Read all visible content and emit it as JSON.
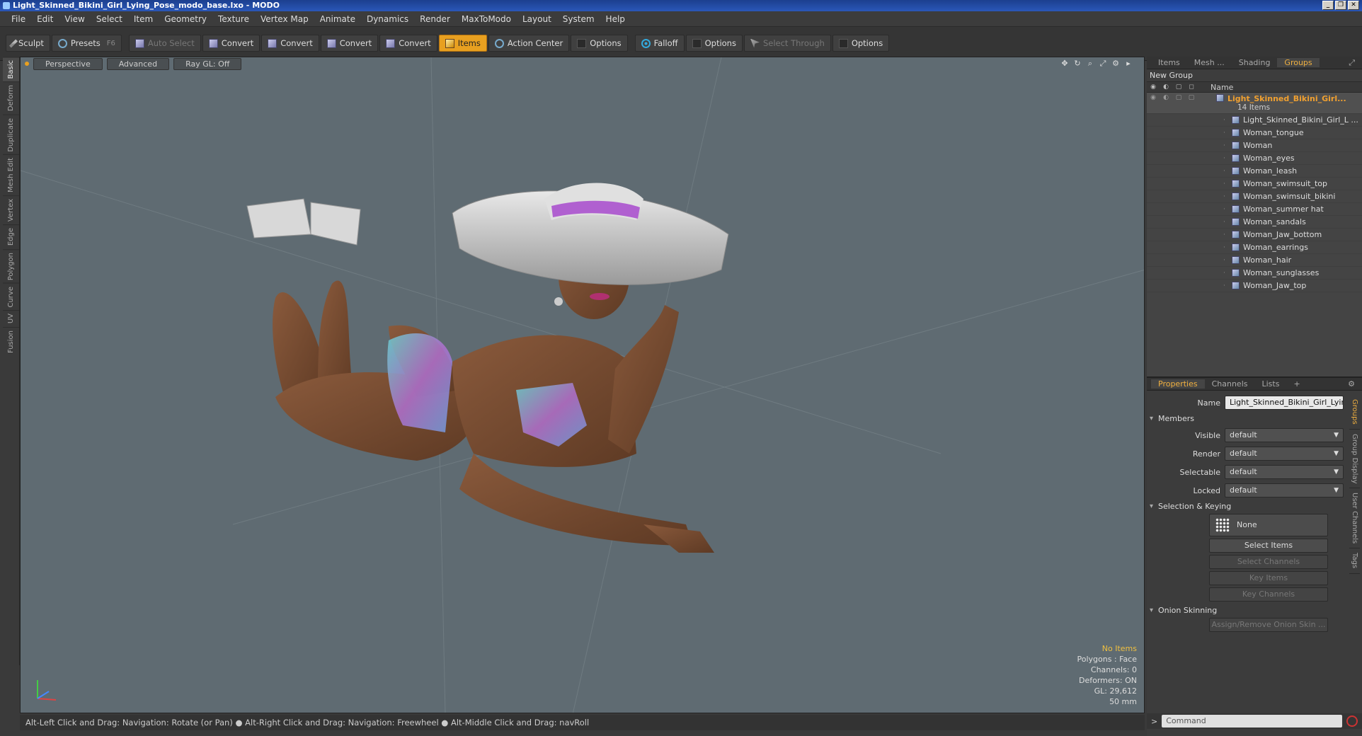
{
  "window": {
    "title": "Light_Skinned_Bikini_Girl_Lying_Pose_modo_base.lxo - MODO",
    "controls": [
      "_",
      "❐",
      "✕"
    ]
  },
  "menu": [
    "File",
    "Edit",
    "View",
    "Select",
    "Item",
    "Geometry",
    "Texture",
    "Vertex Map",
    "Animate",
    "Dynamics",
    "Render",
    "MaxToModo",
    "Layout",
    "System",
    "Help"
  ],
  "toolbar": {
    "sculpt": "Sculpt",
    "presets": "Presets",
    "presets_key": "F6",
    "auto_select": "Auto Select",
    "convert": "Convert",
    "items": "Items",
    "action_center": "Action Center",
    "options": "Options",
    "falloff": "Falloff",
    "select_through": "Select Through"
  },
  "left_tabs": [
    "Basic",
    "Deform",
    "Duplicate",
    "Mesh Edit",
    "Vertex",
    "Edge",
    "Polygon",
    "Curve",
    "UV",
    "Fusion"
  ],
  "viewport": {
    "view_mode": "Perspective",
    "shading": "Advanced",
    "raygl": "Ray GL: Off",
    "stats": {
      "selection": "No Items",
      "polygons": "Polygons : Face",
      "channels": "Channels: 0",
      "deformers": "Deformers: ON",
      "gl": "GL: 29,612",
      "scale": "50 mm"
    }
  },
  "status_bar": "Alt-Left Click and Drag: Navigation: Rotate (or Pan) ● Alt-Right Click and Drag: Navigation: Freewheel ● Alt-Middle Click and Drag: navRoll",
  "right_panel": {
    "tabs": [
      "Items",
      "Mesh ...",
      "Shading",
      "Groups"
    ],
    "active_tab": "Groups",
    "new_group": "New Group",
    "name_header": "Name",
    "root": {
      "name": "Light_Skinned_Bikini_Girl...",
      "count": "14 Items"
    },
    "items": [
      "Light_Skinned_Bikini_Girl_L ...",
      "Woman_tongue",
      "Woman",
      "Woman_eyes",
      "Woman_leash",
      "Woman_swimsuit_top",
      "Woman_swimsuit_bikini",
      "Woman_summer hat",
      "Woman_sandals",
      "Woman_Jaw_bottom",
      "Woman_earrings",
      "Woman_hair",
      "Woman_sunglasses",
      "Woman_Jaw_top"
    ],
    "side_tabs": [
      "Groups",
      "Group Display",
      "User Channels",
      "Tags"
    ],
    "prop_tabs": [
      "Properties",
      "Channels",
      "Lists",
      "+"
    ],
    "properties": {
      "name_label": "Name",
      "name_value": "Light_Skinned_Bikini_Girl_Lying_F",
      "members_section": "Members",
      "rows": [
        {
          "label": "Visible",
          "value": "default"
        },
        {
          "label": "Render",
          "value": "default"
        },
        {
          "label": "Selectable",
          "value": "default"
        },
        {
          "label": "Locked",
          "value": "default"
        }
      ],
      "selection_section": "Selection & Keying",
      "none_btn": "None",
      "select_items": "Select Items",
      "select_channels": "Select Channels",
      "key_items": "Key Items",
      "key_channels": "Key Channels",
      "onion_section": "Onion Skinning",
      "assign_onion": "Assign/Remove Onion Skin ..."
    },
    "command_placeholder": "Command"
  }
}
